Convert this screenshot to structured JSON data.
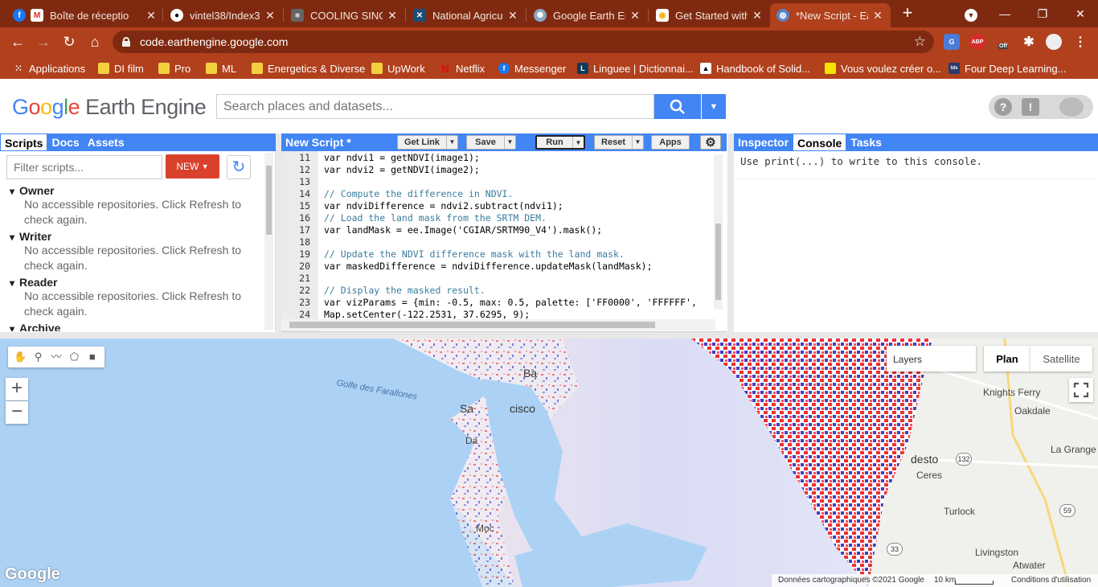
{
  "browser": {
    "tabs": [
      {
        "title": "Boîte de réceptio",
        "icon": "facebook-icon",
        "close": "✕"
      },
      {
        "title": "Boîte de réceptio",
        "icon": "gmail-icon",
        "close": "✕"
      },
      {
        "title": "vintel38/Index3:",
        "icon": "github-icon",
        "close": "✕"
      },
      {
        "title": "COOLING SINGA",
        "icon": "cube-icon",
        "close": "✕"
      },
      {
        "title": "National Agricul",
        "icon": "satellite-icon",
        "close": "✕"
      },
      {
        "title": "Google Earth En",
        "icon": "gear-icon",
        "close": "✕"
      },
      {
        "title": "Get Started with",
        "icon": "colab-icon",
        "close": "✕"
      },
      {
        "title": "*New Script - Ea",
        "icon": "earth-engine-icon",
        "close": "✕"
      }
    ],
    "new_tab": "+",
    "window_controls": {
      "minimize": "—",
      "restore": "❐",
      "close": "✕"
    },
    "url": "code.earthengine.google.com",
    "bookmarks": [
      {
        "label": "Applications",
        "icon": "apps-grid-icon"
      },
      {
        "label": "DI film",
        "icon": "folder-icon"
      },
      {
        "label": "Pro",
        "icon": "folder-icon"
      },
      {
        "label": "ML",
        "icon": "folder-icon"
      },
      {
        "label": "Energetics & Diverse",
        "icon": "folder-icon"
      },
      {
        "label": "UpWork",
        "icon": "folder-icon"
      },
      {
        "label": "Netflix",
        "icon": "netflix-icon"
      },
      {
        "label": "Messenger",
        "icon": "facebook-icon"
      },
      {
        "label": "Linguee | Dictionnai...",
        "icon": "linguee-icon"
      },
      {
        "label": "Handbook of Solid...",
        "icon": "triangle-icon"
      },
      {
        "label": "Vous voulez créer o...",
        "icon": "yellow-square-icon"
      },
      {
        "label": "Four Deep Learning...",
        "icon": "tds-icon"
      }
    ],
    "extensions": {
      "abp": "ABP",
      "off": "Off"
    }
  },
  "gee": {
    "logo_google": [
      "G",
      "o",
      "o",
      "g",
      "l",
      "e"
    ],
    "logo_rest": " Earth Engine",
    "search_placeholder": "Search places and datasets...",
    "help": "?",
    "feedback": "!",
    "left_tabs": [
      "Scripts",
      "Docs",
      "Assets"
    ],
    "filter_placeholder": "Filter scripts...",
    "new_button": "NEW",
    "repos": [
      {
        "name": "Owner",
        "message": "No accessible repositories. Click Refresh to check again."
      },
      {
        "name": "Writer",
        "message": "No accessible repositories. Click Refresh to check again."
      },
      {
        "name": "Reader",
        "message": "No accessible repositories. Click Refresh to check again."
      },
      {
        "name": "Archive",
        "message": ""
      }
    ],
    "editor": {
      "title": "New Script *",
      "buttons": {
        "get_link": "Get Link",
        "save": "Save",
        "run": "Run",
        "reset": "Reset",
        "apps": "Apps"
      },
      "lines": [
        {
          "n": "11",
          "code": "var ndvi1 = getNDVI(image1);"
        },
        {
          "n": "12",
          "code": "var ndvi2 = getNDVI(image2);"
        },
        {
          "n": "13",
          "code": ""
        },
        {
          "n": "14",
          "code": "// Compute the difference in NDVI."
        },
        {
          "n": "15",
          "code": "var ndviDifference = ndvi2.subtract(ndvi1);"
        },
        {
          "n": "16",
          "code": "// Load the land mask from the SRTM DEM."
        },
        {
          "n": "17",
          "code": "var landMask = ee.Image('CGIAR/SRTM90_V4').mask();"
        },
        {
          "n": "18",
          "code": ""
        },
        {
          "n": "19",
          "code": "// Update the NDVI difference mask with the land mask."
        },
        {
          "n": "20",
          "code": "var maskedDifference = ndviDifference.updateMask(landMask);"
        },
        {
          "n": "21",
          "code": ""
        },
        {
          "n": "22",
          "code": "// Display the masked result."
        },
        {
          "n": "23",
          "code": "var vizParams = {min: -0.5, max: 0.5, palette: ['FF0000', 'FFFFFF',"
        },
        {
          "n": "24",
          "code": "Map.setCenter(-122.2531, 37.6295, 9);"
        },
        {
          "n": "25",
          "code": ""
        }
      ]
    },
    "right_tabs": [
      "Inspector",
      "Console",
      "Tasks"
    ],
    "console_message": "Use print(...) to write to this console."
  },
  "map": {
    "layers_label": "Layers",
    "map_type": [
      "Plan",
      "Satellite"
    ],
    "zoom_in": "+",
    "zoom_out": "−",
    "places": [
      "Ba",
      "Sa",
      "cisco",
      "Da",
      "Moc",
      "desto",
      "Ceres",
      "Turlock",
      "Livingston",
      "Atwater",
      "Knights Ferry",
      "Oakdale",
      "La Grange"
    ],
    "water_label": "Golfe des Farallones",
    "shields": [
      "132",
      "59",
      "33"
    ],
    "google_logo": "Google",
    "footer": {
      "attribution": "Données cartographiques ©2021 Google",
      "scale": "10 km",
      "terms": "Conditions d'utilisation"
    }
  }
}
